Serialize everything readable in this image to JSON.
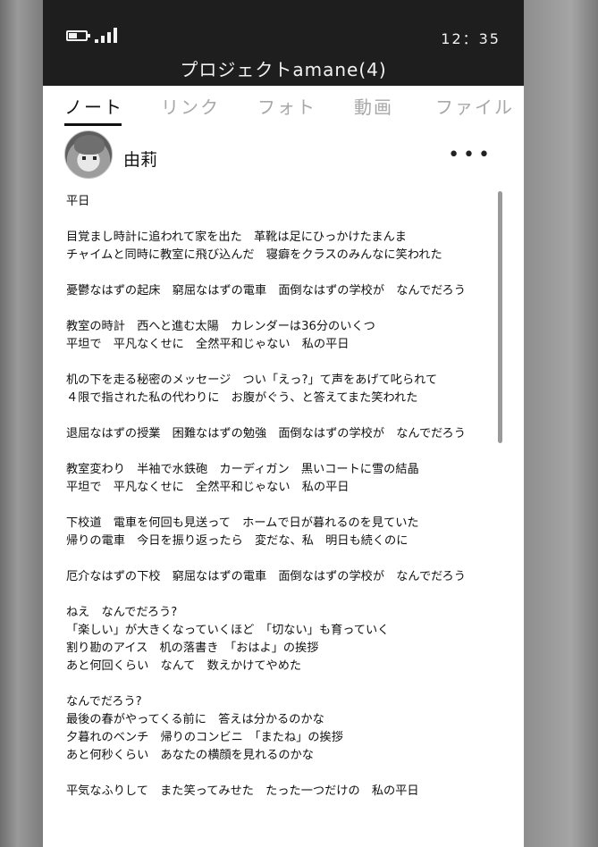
{
  "status": {
    "time": "12：35",
    "battery_icon": "battery-icon",
    "signal_icon": "signal-icon"
  },
  "header": {
    "title": "プロジェクトamane(4)"
  },
  "tabs": [
    {
      "label": "ノート",
      "active": true
    },
    {
      "label": "リンク",
      "active": false
    },
    {
      "label": "フォト",
      "active": false
    },
    {
      "label": "動画",
      "active": false
    },
    {
      "label": "ファイル",
      "active": false
    }
  ],
  "post": {
    "author": "由莉",
    "more_icon": "more-icon",
    "paragraphs": [
      [
        "平日"
      ],
      [
        "目覚まし時計に追われて家を出た　革靴は足にひっかけたまんま",
        "チャイムと同時に教室に飛び込んだ　寝癖をクラスのみんなに笑われた"
      ],
      [
        "憂鬱なはずの起床　窮屈なはずの電車　面倒なはずの学校が　なんでだろう"
      ],
      [
        "教室の時計　西へと進む太陽　カレンダーは36分のいくつ",
        "平坦で　平凡なくせに　全然平和じゃない　私の平日"
      ],
      [
        "机の下を走る秘密のメッセージ　つい「えっ?」て声をあげて叱られて",
        "４限で指された私の代わりに　お腹がぐう、と答えてまた笑われた"
      ],
      [
        "退屈なはずの授業　困難なはずの勉強　面倒なはずの学校が　なんでだろう"
      ],
      [
        "教室変わり　半袖で水鉄砲　カーディガン　黒いコートに雪の結晶",
        "平坦で　平凡なくせに　全然平和じゃない　私の平日"
      ],
      [
        "下校道　電車を何回も見送って　ホームで日が暮れるのを見ていた",
        "帰りの電車　今日を振り返ったら　変だな、私　明日も続くのに"
      ],
      [
        "厄介なはずの下校　窮屈なはずの電車　面倒なはずの学校が　なんでだろう"
      ],
      [
        "ねえ　なんでだろう?",
        "「楽しい」が大きくなっていくほど　「切ない」も育っていく",
        "割り勘のアイス　机の落書き　「おはよ」の挨拶",
        "あと何回くらい　なんて　数えかけてやめた"
      ],
      [
        "なんでだろう?",
        "最後の春がやってくる前に　答えは分かるのかな",
        "夕暮れのベンチ　帰りのコンビニ　「またね」の挨拶",
        "あと何秒くらい　あなたの横顔を見れるのかな"
      ],
      [
        "平気なふりして　また笑ってみせた　たった一つだけの　私の平日"
      ]
    ]
  }
}
